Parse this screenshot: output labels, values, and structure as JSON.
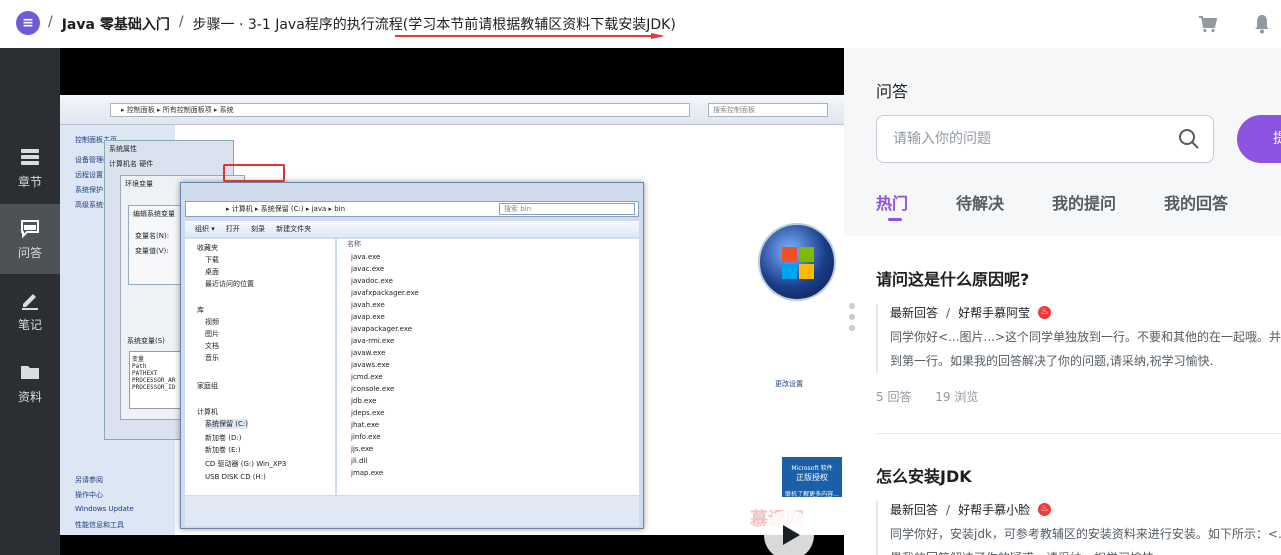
{
  "header": {
    "logo_text": "≡",
    "breadcrumb": [
      "Java 零基础入门",
      "步骤一 · 3-1 Java程序的执行流程(学习本节前请根据教辅区资料下载安装JDK)"
    ],
    "separator": "/",
    "icons": [
      "cart-icon",
      "bell-icon"
    ]
  },
  "sidebar": {
    "items": [
      {
        "label": "章节",
        "icon": "chapter-icon"
      },
      {
        "label": "问答",
        "icon": "qa-icon",
        "active": true
      },
      {
        "label": "笔记",
        "icon": "note-icon"
      },
      {
        "label": "资料",
        "icon": "folder-icon"
      }
    ]
  },
  "video": {
    "address": "▸ 控制面板 ▸ 所有控制面板项 ▸ 系统",
    "search_placeholder": "搜索控制面板",
    "explorer_path": "▸ 计算机 ▸ 系统保留 (C:) ▸ java ▸ bin",
    "explorer_search": "搜索 bin",
    "toolbar": "组织 ▾     打开     刻录     新建文件夹",
    "left_labels": [
      "控制面板主页",
      "设备管理器",
      "远程设置",
      "系统保护",
      "高级系统设置",
      "另请参阅",
      "操作中心",
      "Windows Update",
      "性能信息和工具"
    ],
    "tree": [
      "收藏夹",
      "下载",
      "桌面",
      "最近访问的位置",
      "库",
      "视频",
      "图片",
      "文档",
      "音乐",
      "家庭组",
      "计算机",
      "系统保留 (C:)",
      "新加卷 (D:)",
      "新加卷 (E:)",
      "CD 驱动器 (G:) Win_XP3",
      "USB DISK CD (H:)"
    ],
    "files_header": "名称",
    "files": [
      "java.exe",
      "javac.exe",
      "javadoc.exe",
      "javafxpackager.exe",
      "javah.exe",
      "javap.exe",
      "javapackager.exe",
      "java-rmi.exe",
      "javaw.exe",
      "javaws.exe",
      "jcmd.exe",
      "jconsole.exe",
      "jdb.exe",
      "jdeps.exe",
      "jhat.exe",
      "jinfo.exe",
      "jjs.exe",
      "jli.dll",
      "jmap.exe"
    ],
    "dialog_title": "系统属性",
    "dialog_tabs": "计算机名  硬件",
    "env_title": "环境变量",
    "edit_title": "编辑系统变量",
    "var_name_label": "变量名(N):",
    "var_value_label": "变量值(V):",
    "sys_vars_label": "系统变量(S)",
    "var_col": "变量",
    "var_rows": [
      "Path",
      "PATHEXT",
      "PROCESSOR_AR",
      "PROCESSOR_ID"
    ],
    "change_settings": "更改设置",
    "auth_badge": "正版授权",
    "auth_top": "Microsoft 软件",
    "auth_link": "联机了解更多内容...",
    "watermark": "慕课网"
  },
  "qa": {
    "title": "问答",
    "search_placeholder": "请输入你的问题",
    "ask_label": "提问",
    "tabs": [
      "热门",
      "待解决",
      "我的提问",
      "我的回答"
    ],
    "questions": [
      {
        "title": "请问这是什么原因呢?",
        "latest_label": "最新回答",
        "sep": "/",
        "author": "好帮手慕阿莹",
        "body_line1": "同学你好<...图片...>这个同学单独放到一行。不要和其他的在一起哦。并且",
        "body_line2": "到第一行。如果我的回答解决了你的问题,请采纳,祝学习愉快.",
        "answers": "5 回答",
        "views": "19 浏览"
      },
      {
        "title": "怎么安装JDK",
        "latest_label": "最新回答",
        "sep": "/",
        "author": "好帮手慕小脸",
        "body_line1": "同学你好，安装jdk，可参考教辅区的安装资料来进行安装。如下所示：<...",
        "body_line2": "果我的回答解决了你的疑惑，请采纳，祝学习愉快~"
      }
    ]
  },
  "colors": {
    "accent": "#8c52e0",
    "nav_bg": "#2b2f33",
    "nav_active": "#4d5256",
    "underline": "#e53935"
  }
}
